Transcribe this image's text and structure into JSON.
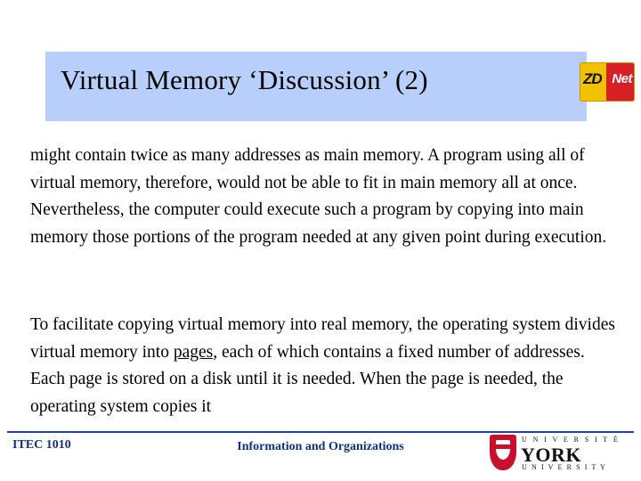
{
  "slide": {
    "title": "Virtual Memory ‘Discussion’ (2)",
    "logo": {
      "zd_text": "ZD",
      "net_text": "Net"
    },
    "paragraphs": {
      "p1": "might contain twice as many addresses as main memory. A program using all of virtual memory, therefore, would not be able to fit in main memory all at once. Nevertheless, the computer could execute such a program by copying into main memory those portions of the program needed at any given point during execution.",
      "p2_part1": "To facilitate copying virtual memory into real memory, the operating system divides virtual memory into ",
      "p2_underlined": "pages",
      "p2_part2": ", each of which contains a fixed number of addresses. Each page is stored on a disk until it is needed. When the page is needed, the operating system copies it"
    },
    "footer": {
      "left": "ITEC 1010",
      "center": "Information and Organizations",
      "university_top": "U N I V E R S I T É",
      "university_name": "YORK",
      "university_bottom": "U N I V E R S I T Y"
    },
    "colors": {
      "title_band": "#b8cffb",
      "footer_text": "#12307e",
      "footer_rule": "#1f3fa8",
      "logo_yellow": "#f2c200",
      "logo_red": "#d81f26",
      "crest_red": "#c8102e"
    }
  }
}
